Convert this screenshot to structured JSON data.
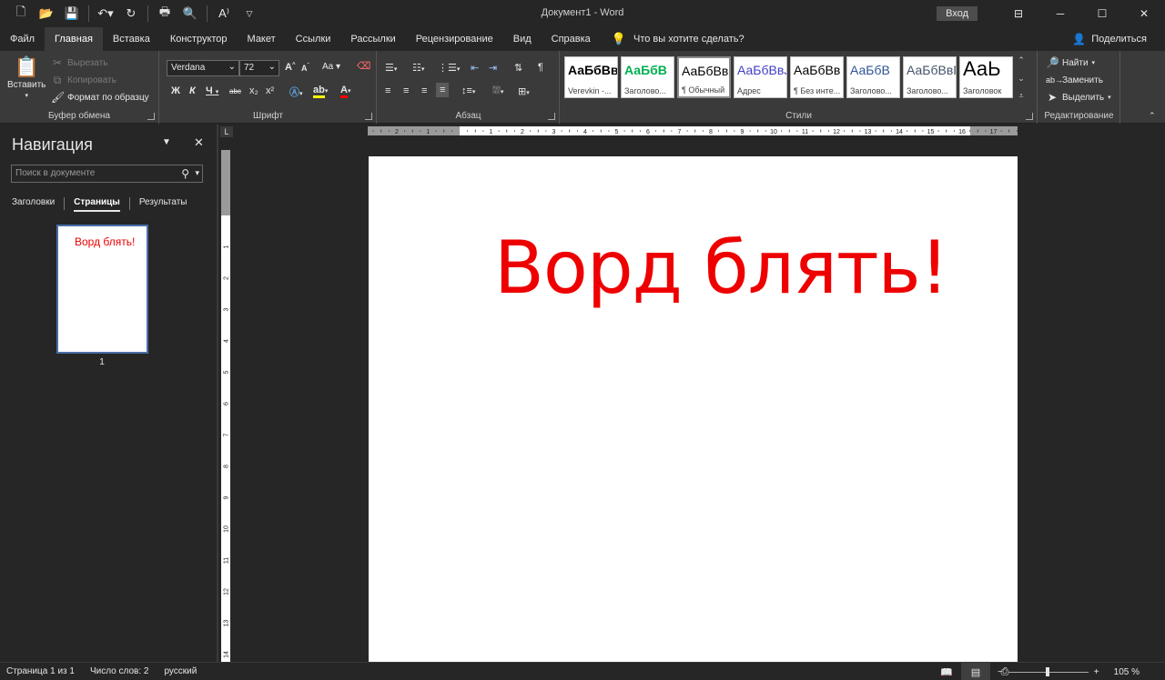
{
  "title_bar": {
    "title": "Документ1  -  Word",
    "signin": "Вход",
    "qat_icons": [
      "new-doc-icon",
      "open-icon",
      "save-icon",
      "undo-icon",
      "redo-icon",
      "print-preview-icon",
      "find-icon",
      "read-aloud-icon",
      "customize-icon"
    ]
  },
  "tabs": [
    "Файл",
    "Главная",
    "Вставка",
    "Конструктор",
    "Макет",
    "Ссылки",
    "Рассылки",
    "Рецензирование",
    "Вид",
    "Справка"
  ],
  "active_tab": "Главная",
  "tell_me": "Что вы хотите сделать?",
  "share": "Поделиться",
  "ribbon": {
    "clipboard": {
      "label": "Буфер обмена",
      "paste": "Вставить",
      "cut": "Вырезать",
      "copy": "Копировать",
      "format_painter": "Формат по образцу"
    },
    "font": {
      "label": "Шрифт",
      "font_name": "Verdana",
      "font_size": "72",
      "bold": "Ж",
      "italic": "К",
      "underline": "Ч",
      "strike": "abc",
      "subscript": "x₂",
      "superscript": "x²",
      "grow": "A",
      "shrink": "A",
      "case": "Aa"
    },
    "paragraph": {
      "label": "Абзац"
    },
    "styles": {
      "label": "Стили",
      "items": [
        {
          "sample": "АаБбВвI",
          "name": "Verevkin -...",
          "color": "#000000",
          "bold": true
        },
        {
          "sample": "АаБбВ",
          "name": "Заголово...",
          "color": "#00b050",
          "bold": true
        },
        {
          "sample": "АаБбВв",
          "name": "¶ Обычный",
          "color": "#000000",
          "bold": false
        },
        {
          "sample": "АаБбВвJ",
          "name": "Адрес",
          "color": "#4040c0",
          "bold": false
        },
        {
          "sample": "АаБбВв",
          "name": "¶ Без инте...",
          "color": "#000000",
          "bold": false
        },
        {
          "sample": "АаБбВ",
          "name": "Заголово...",
          "color": "#2f5496",
          "bold": false
        },
        {
          "sample": "АаБбВвГ",
          "name": "Заголово...",
          "color": "#44546a",
          "bold": false
        },
        {
          "sample": "АаЬ",
          "name": "Заголовок",
          "color": "#000000",
          "bold": false
        }
      ]
    },
    "editing": {
      "label": "Редактирование",
      "find": "Найти",
      "replace": "Заменить",
      "select": "Выделить"
    }
  },
  "nav": {
    "title": "Навигация",
    "search_placeholder": "Поиск в документе",
    "tabs": [
      "Заголовки",
      "Страницы",
      "Результаты"
    ],
    "active_tab": "Страницы",
    "thumb_text": "Ворд блять!",
    "thumb_page": "1"
  },
  "ruler": {
    "h_labels": [
      "3",
      "2",
      "1",
      "1",
      "2",
      "3",
      "4",
      "5",
      "6",
      "7",
      "8",
      "9",
      "10",
      "11",
      "12",
      "13",
      "14",
      "15",
      "16",
      "17"
    ],
    "v_labels": [
      "2",
      "1",
      "1",
      "2",
      "3",
      "4",
      "5",
      "6",
      "7",
      "8",
      "9",
      "10",
      "11",
      "12",
      "13",
      "14"
    ],
    "corner": "L"
  },
  "document": {
    "text": "Ворд блять!",
    "text_color": "#ee0000"
  },
  "status": {
    "page": "Страница 1 из 1",
    "words": "Число слов: 2",
    "language": "русский",
    "zoom": "105 %"
  }
}
